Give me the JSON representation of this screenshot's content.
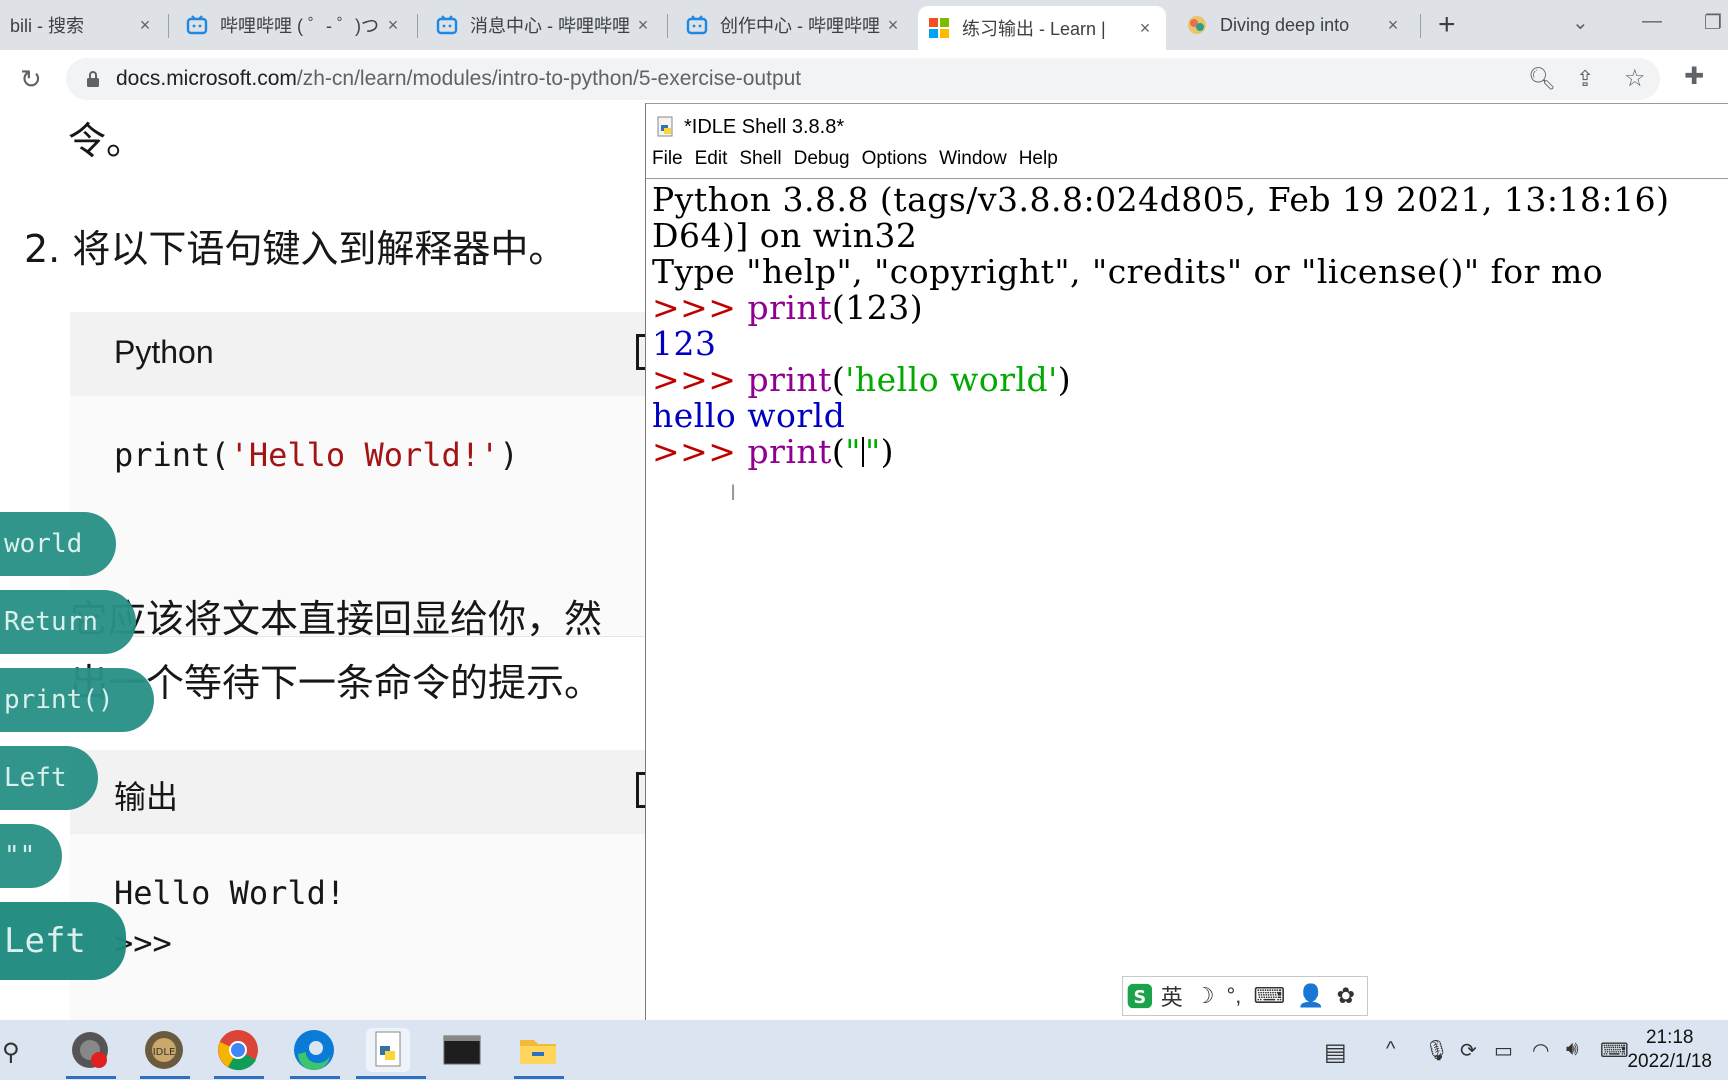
{
  "browser": {
    "tabs": [
      {
        "title": "bili - 搜索",
        "close": "×"
      },
      {
        "title": "哔哩哔哩 ( ゜- ゜)つ",
        "close": "×"
      },
      {
        "title": "消息中心 - 哔哩哔哩",
        "close": "×"
      },
      {
        "title": "创作中心 - 哔哩哔哩",
        "close": "×"
      },
      {
        "title": "练习输出 - Learn |",
        "close": "×"
      },
      {
        "title": "Diving deep into",
        "close": "×"
      }
    ],
    "new_tab": "+",
    "url_host": "docs.microsoft.com",
    "url_path": "/zh-cn/learn/modules/intro-to-python/5-exercise-output"
  },
  "learn": {
    "fragment_top": "令。",
    "step_number": "2.",
    "step_text": "将以下语句键入到解释器中。",
    "code_lang": "Python",
    "code_fn": "print(",
    "code_str": "'Hello World!'",
    "code_close": ")",
    "para_line1": "它应该将文本直接回显给你，然",
    "para_line2": "出一个等待下一条命令的提示。",
    "output_label": "输出",
    "output_line1": "Hello World!",
    "output_line2": ">>>"
  },
  "key_overlays": [
    "world",
    "Return",
    "print()",
    "Left",
    "\"\"",
    "Left"
  ],
  "idle": {
    "title": "*IDLE Shell 3.8.8*",
    "menu": [
      "File",
      "Edit",
      "Shell",
      "Debug",
      "Options",
      "Window",
      "Help"
    ],
    "banner1": "Python 3.8.8 (tags/v3.8.8:024d805, Feb 19 2021, 13:18:16)",
    "banner2": "D64)] on win32",
    "banner3": "Type \"help\", \"copyright\", \"credits\" or \"license()\" for mo",
    "prompt": ">>> ",
    "cmd1_fn": "print",
    "cmd1_args": "(123)",
    "out1": "123",
    "cmd2_fn": "print",
    "cmd2_open": "(",
    "cmd2_str": "'hello world'",
    "cmd2_close": ")",
    "out2": "hello world",
    "cmd3_fn": "print",
    "cmd3_open": "(",
    "cmd3_q1": "\"",
    "cmd3_q2": "\"",
    "cmd3_close": ")"
  },
  "ime": {
    "mode": "英",
    "items": [
      "☽",
      "°,",
      "⌨",
      "👤",
      "✿"
    ]
  },
  "taskbar": {
    "time": "21:18",
    "date": "2022/1/18"
  },
  "colors": {
    "accent_teal": "#2a9187",
    "idle_prompt": "#c00000",
    "idle_keyword": "#900090",
    "idle_string": "#00aa00",
    "idle_output": "#0000c0"
  }
}
